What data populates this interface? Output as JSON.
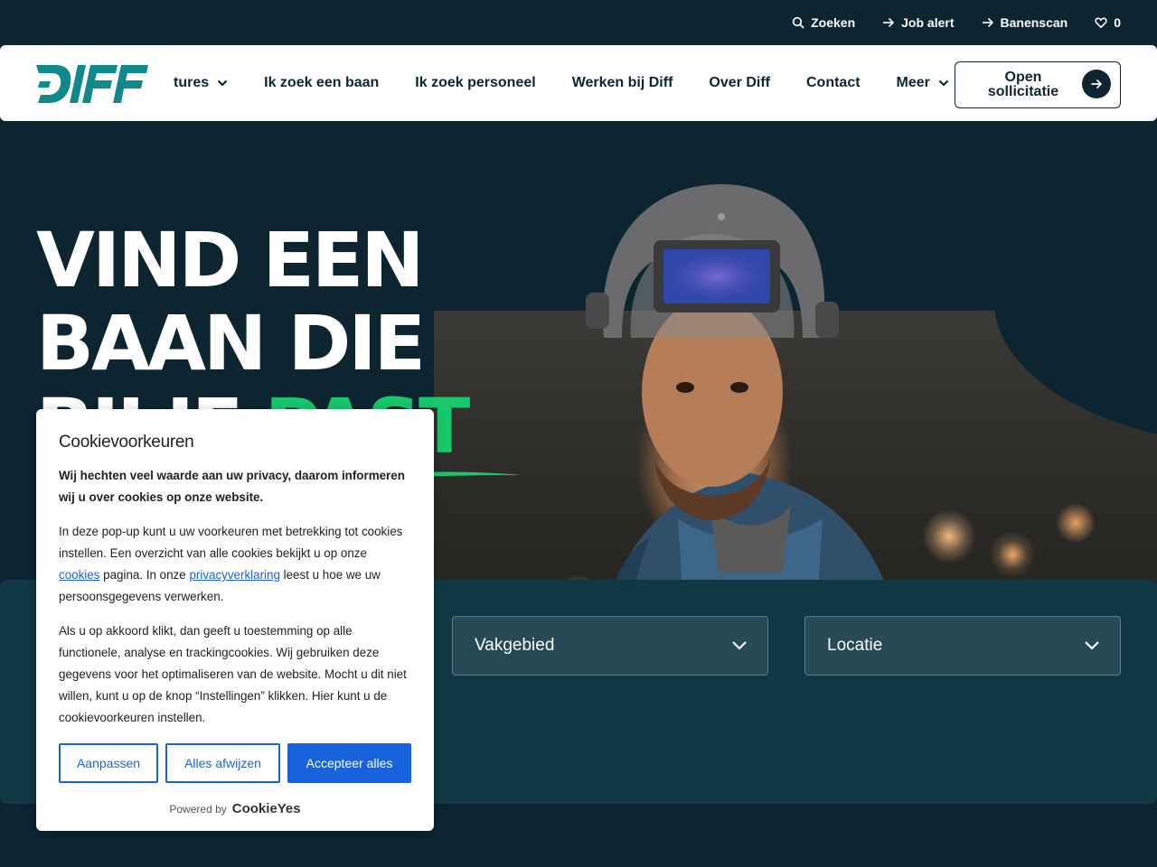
{
  "topbar": {
    "links": [
      {
        "label": "Zoeken",
        "icon": "search-icon"
      },
      {
        "label": "Job alert",
        "icon": "arrow-right-icon"
      },
      {
        "label": "Banenscan",
        "icon": "arrow-right-icon"
      },
      {
        "label": "0",
        "icon": "heart-icon"
      }
    ]
  },
  "nav": {
    "logo_alt": "DIFF",
    "items": [
      {
        "label": "tures",
        "has_dropdown": true
      },
      {
        "label": "Ik zoek een baan",
        "has_dropdown": false
      },
      {
        "label": "Ik zoek personeel",
        "has_dropdown": false
      },
      {
        "label": "Werken bij Diff",
        "has_dropdown": false
      },
      {
        "label": "Over Diff",
        "has_dropdown": false
      },
      {
        "label": "Contact",
        "has_dropdown": false
      },
      {
        "label": "Meer",
        "has_dropdown": true
      }
    ],
    "cta_line1": "Open",
    "cta_line2": "sollicitatie"
  },
  "hero": {
    "title_line1": "VIND EEN",
    "title_line2": "BAAN DIE",
    "title_line3_a": "BIJ JE ",
    "title_line3_b": "PAST"
  },
  "search": {
    "field1": "Vakgebied",
    "field2": "Locatie"
  },
  "cookie": {
    "title": "Cookievoorkeuren",
    "intro": "Wij hechten veel waarde aan uw privacy, daarom informeren wij u over cookies op onze website.",
    "p1_a": "In deze pop-up kunt u uw voorkeuren met betrekking tot cookies instellen. Een overzicht van alle cookies bekijkt u op onze ",
    "p1_link1": "cookies",
    "p1_b": " pagina. In onze ",
    "p1_link2": "privacyverklaring",
    "p1_c": " leest u hoe we uw persoonsgegevens verwerken.",
    "p2": "Als u op akkoord klikt, dan geeft u toestemming op alle functionele, analyse en trackingcookies. Wij gebruiken deze gegevens voor het optimaliseren van de website. Mocht u dit niet willen, kunt u op de knop “Instellingen” klikken. Hier kunt u de cookievoorkeuren instellen.",
    "btn_customize": "Aanpassen",
    "btn_reject": "Alles afwijzen",
    "btn_accept": "Accepteer alles",
    "powered_by": "Powered by",
    "brand": "CookieYes"
  },
  "colors": {
    "dark": "#0c2530",
    "panel": "#103845",
    "accent_green": "#19c86b",
    "logo_teal": "#0e8a8a",
    "cookie_blue": "#1863dc"
  }
}
